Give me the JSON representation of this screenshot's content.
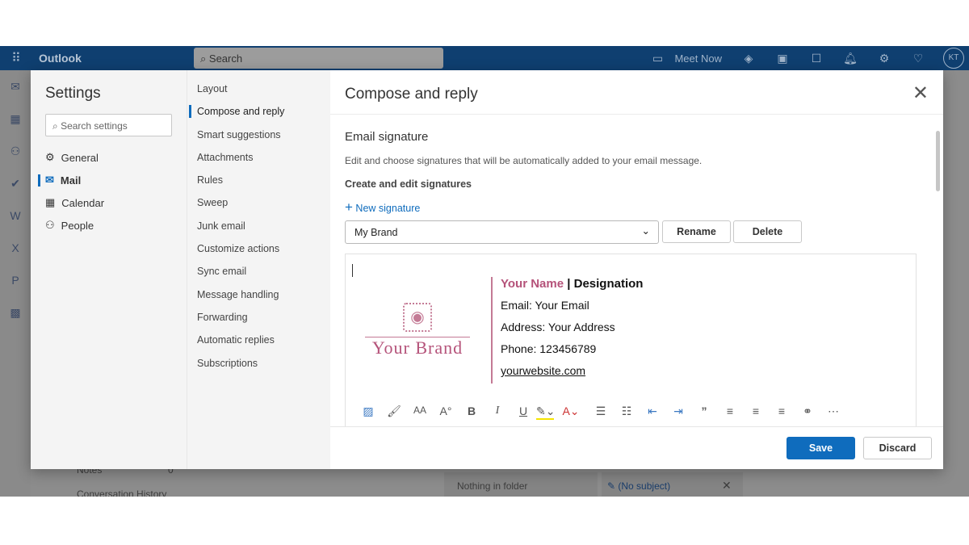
{
  "topbar": {
    "app_name": "Outlook",
    "search_placeholder": "Search",
    "meet_now": "Meet Now",
    "avatar_initials": "KT"
  },
  "background": {
    "notes_label": "Notes",
    "notes_count": "0",
    "conversation_history": "Conversation History",
    "nothing_in_folder": "Nothing in folder",
    "draft_subject": "(No subject)"
  },
  "settings": {
    "title": "Settings",
    "search_placeholder": "Search settings",
    "categories": [
      {
        "label": "General",
        "icon": "gear-icon"
      },
      {
        "label": "Mail",
        "icon": "mail-icon",
        "active": true
      },
      {
        "label": "Calendar",
        "icon": "calendar-icon"
      },
      {
        "label": "People",
        "icon": "people-icon"
      }
    ],
    "mail_sections": [
      "Layout",
      "Compose and reply",
      "Smart suggestions",
      "Attachments",
      "Rules",
      "Sweep",
      "Junk email",
      "Customize actions",
      "Sync email",
      "Message handling",
      "Forwarding",
      "Automatic replies",
      "Subscriptions"
    ],
    "active_section": "Compose and reply"
  },
  "content": {
    "title": "Compose and reply",
    "section_title": "Email signature",
    "description": "Edit and choose signatures that will be automatically added to your email message.",
    "create_label": "Create and edit signatures",
    "new_signature": "New signature",
    "selected_signature": "My Brand",
    "rename": "Rename",
    "delete": "Delete",
    "signature": {
      "brand": "Your Brand",
      "name": "Your Name",
      "separator": " | ",
      "designation": "Designation",
      "email_label": "Email:",
      "email": " Your Email",
      "address_label": "Address:",
      "address": " Your Address",
      "phone_label": "Phone:",
      "phone": " 123456789",
      "website": "yourwebsite.com",
      "accent_color": "#b5537a"
    },
    "save": "Save",
    "discard": "Discard"
  },
  "colors": {
    "header": "#0f3f70",
    "accent": "#0f6cbd"
  }
}
